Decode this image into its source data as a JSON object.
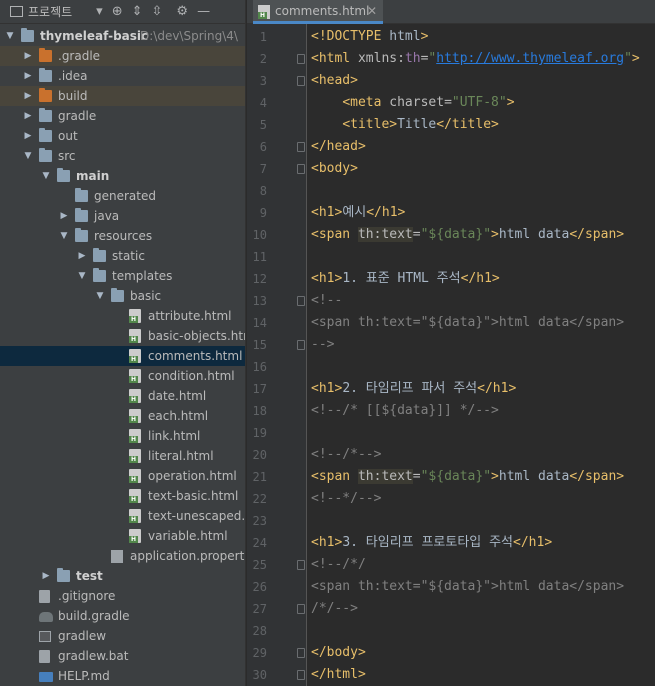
{
  "project_panel": {
    "title": "프로젝트",
    "tree": [
      {
        "label": "thymeleaf-basic",
        "hint": "D:\\dev\\Spring\\4\\",
        "indent": 0,
        "arrow": "down",
        "icon": "folder",
        "bold": true
      },
      {
        "label": ".gradle",
        "indent": 1,
        "arrow": "right",
        "icon": "folder-orange",
        "excluded": true
      },
      {
        "label": ".idea",
        "indent": 1,
        "arrow": "right",
        "icon": "folder"
      },
      {
        "label": "build",
        "indent": 1,
        "arrow": "right",
        "icon": "folder-orange",
        "excluded": true
      },
      {
        "label": "gradle",
        "indent": 1,
        "arrow": "right",
        "icon": "folder"
      },
      {
        "label": "out",
        "indent": 1,
        "arrow": "right",
        "icon": "folder"
      },
      {
        "label": "src",
        "indent": 1,
        "arrow": "down",
        "icon": "folder"
      },
      {
        "label": "main",
        "indent": 2,
        "arrow": "down",
        "icon": "folder",
        "bold": true
      },
      {
        "label": "generated",
        "indent": 3,
        "arrow": "",
        "icon": "folder"
      },
      {
        "label": "java",
        "indent": 3,
        "arrow": "right",
        "icon": "folder"
      },
      {
        "label": "resources",
        "indent": 3,
        "arrow": "down",
        "icon": "folder"
      },
      {
        "label": "static",
        "indent": 4,
        "arrow": "right",
        "icon": "folder"
      },
      {
        "label": "templates",
        "indent": 4,
        "arrow": "down",
        "icon": "folder"
      },
      {
        "label": "basic",
        "indent": 5,
        "arrow": "down",
        "icon": "folder"
      },
      {
        "label": "attribute.html",
        "indent": 6,
        "arrow": "",
        "icon": "html"
      },
      {
        "label": "basic-objects.html",
        "indent": 6,
        "arrow": "",
        "icon": "html"
      },
      {
        "label": "comments.html",
        "indent": 6,
        "arrow": "",
        "icon": "html",
        "selected": true
      },
      {
        "label": "condition.html",
        "indent": 6,
        "arrow": "",
        "icon": "html"
      },
      {
        "label": "date.html",
        "indent": 6,
        "arrow": "",
        "icon": "html"
      },
      {
        "label": "each.html",
        "indent": 6,
        "arrow": "",
        "icon": "html"
      },
      {
        "label": "link.html",
        "indent": 6,
        "arrow": "",
        "icon": "html"
      },
      {
        "label": "literal.html",
        "indent": 6,
        "arrow": "",
        "icon": "html"
      },
      {
        "label": "operation.html",
        "indent": 6,
        "arrow": "",
        "icon": "html"
      },
      {
        "label": "text-basic.html",
        "indent": 6,
        "arrow": "",
        "icon": "html"
      },
      {
        "label": "text-unescaped.ht",
        "indent": 6,
        "arrow": "",
        "icon": "html"
      },
      {
        "label": "variable.html",
        "indent": 6,
        "arrow": "",
        "icon": "html"
      },
      {
        "label": "application.properties",
        "indent": 5,
        "arrow": "",
        "icon": "prop"
      },
      {
        "label": "test",
        "indent": 2,
        "arrow": "right",
        "icon": "folder",
        "bold": true
      },
      {
        "label": ".gitignore",
        "indent": 1,
        "arrow": "",
        "icon": "plain"
      },
      {
        "label": "build.gradle",
        "indent": 1,
        "arrow": "",
        "icon": "elephant"
      },
      {
        "label": "gradlew",
        "indent": 1,
        "arrow": "",
        "icon": "term"
      },
      {
        "label": "gradlew.bat",
        "indent": 1,
        "arrow": "",
        "icon": "plain"
      },
      {
        "label": "HELP.md",
        "indent": 1,
        "arrow": "",
        "icon": "md"
      }
    ]
  },
  "editor": {
    "tab_label": "comments.html",
    "lines": [
      [
        [
          "tag",
          "<!DOCTYPE "
        ],
        [
          "",
          "html"
        ],
        [
          "tag",
          ">"
        ]
      ],
      [
        [
          "tag",
          "<html "
        ],
        [
          "attr",
          "xmlns:"
        ],
        [
          "ns",
          "th"
        ],
        [
          "attr",
          "="
        ],
        [
          "str",
          "\""
        ],
        [
          "url",
          "http://www.thymeleaf.org"
        ],
        [
          "str",
          "\""
        ],
        [
          "tag",
          ">"
        ]
      ],
      [
        [
          "tag",
          "<head>"
        ]
      ],
      [
        [
          "",
          "    "
        ],
        [
          "tag",
          "<meta "
        ],
        [
          "attr",
          "charset"
        ],
        [
          "attr",
          "="
        ],
        [
          "str",
          "\"UTF-8\""
        ],
        [
          "tag",
          ">"
        ]
      ],
      [
        [
          "",
          "    "
        ],
        [
          "tag",
          "<title>"
        ],
        [
          "",
          "Title"
        ],
        [
          "tag",
          "</title>"
        ]
      ],
      [
        [
          "tag",
          "</head>"
        ]
      ],
      [
        [
          "tag",
          "<body>"
        ]
      ],
      [],
      [
        [
          "tag",
          "<h1>"
        ],
        [
          "",
          "예시"
        ],
        [
          "tag",
          "</h1>"
        ]
      ],
      [
        [
          "tag",
          "<span "
        ],
        [
          "hlattr",
          "th:text"
        ],
        [
          "attr",
          "="
        ],
        [
          "str",
          "\"${data}\""
        ],
        [
          "tag",
          ">"
        ],
        [
          "",
          "html data"
        ],
        [
          "tag",
          "</span>"
        ]
      ],
      [],
      [
        [
          "tag",
          "<h1>"
        ],
        [
          "",
          "1. 표준 HTML 주석"
        ],
        [
          "tag",
          "</h1>"
        ]
      ],
      [
        [
          "com",
          "<!--"
        ]
      ],
      [
        [
          "com",
          "<span th:text=\"${data}\">html data</span>"
        ]
      ],
      [
        [
          "com",
          "-->"
        ]
      ],
      [],
      [
        [
          "tag",
          "<h1>"
        ],
        [
          "",
          "2. 타임리프 파서 주석"
        ],
        [
          "tag",
          "</h1>"
        ]
      ],
      [
        [
          "com",
          "<!--/* [[${data}]] */-->"
        ]
      ],
      [],
      [
        [
          "com",
          "<!--/*-->"
        ]
      ],
      [
        [
          "tag",
          "<span "
        ],
        [
          "hlattr",
          "th:text"
        ],
        [
          "attr",
          "="
        ],
        [
          "str",
          "\"${data}\""
        ],
        [
          "tag",
          ">"
        ],
        [
          "",
          "html data"
        ],
        [
          "tag",
          "</span>"
        ]
      ],
      [
        [
          "com",
          "<!--*/-->"
        ]
      ],
      [],
      [
        [
          "tag",
          "<h1>"
        ],
        [
          "",
          "3. 타임리프 프로토타입 주석"
        ],
        [
          "tag",
          "</h1>"
        ]
      ],
      [
        [
          "com",
          "<!--/*/"
        ]
      ],
      [
        [
          "com",
          "<span th:text=\"${data}\">html data</span>"
        ]
      ],
      [
        [
          "com",
          "/*/-->"
        ]
      ],
      [],
      [
        [
          "tag",
          "</body>"
        ]
      ],
      [
        [
          "tag",
          "</html>"
        ]
      ]
    ]
  }
}
